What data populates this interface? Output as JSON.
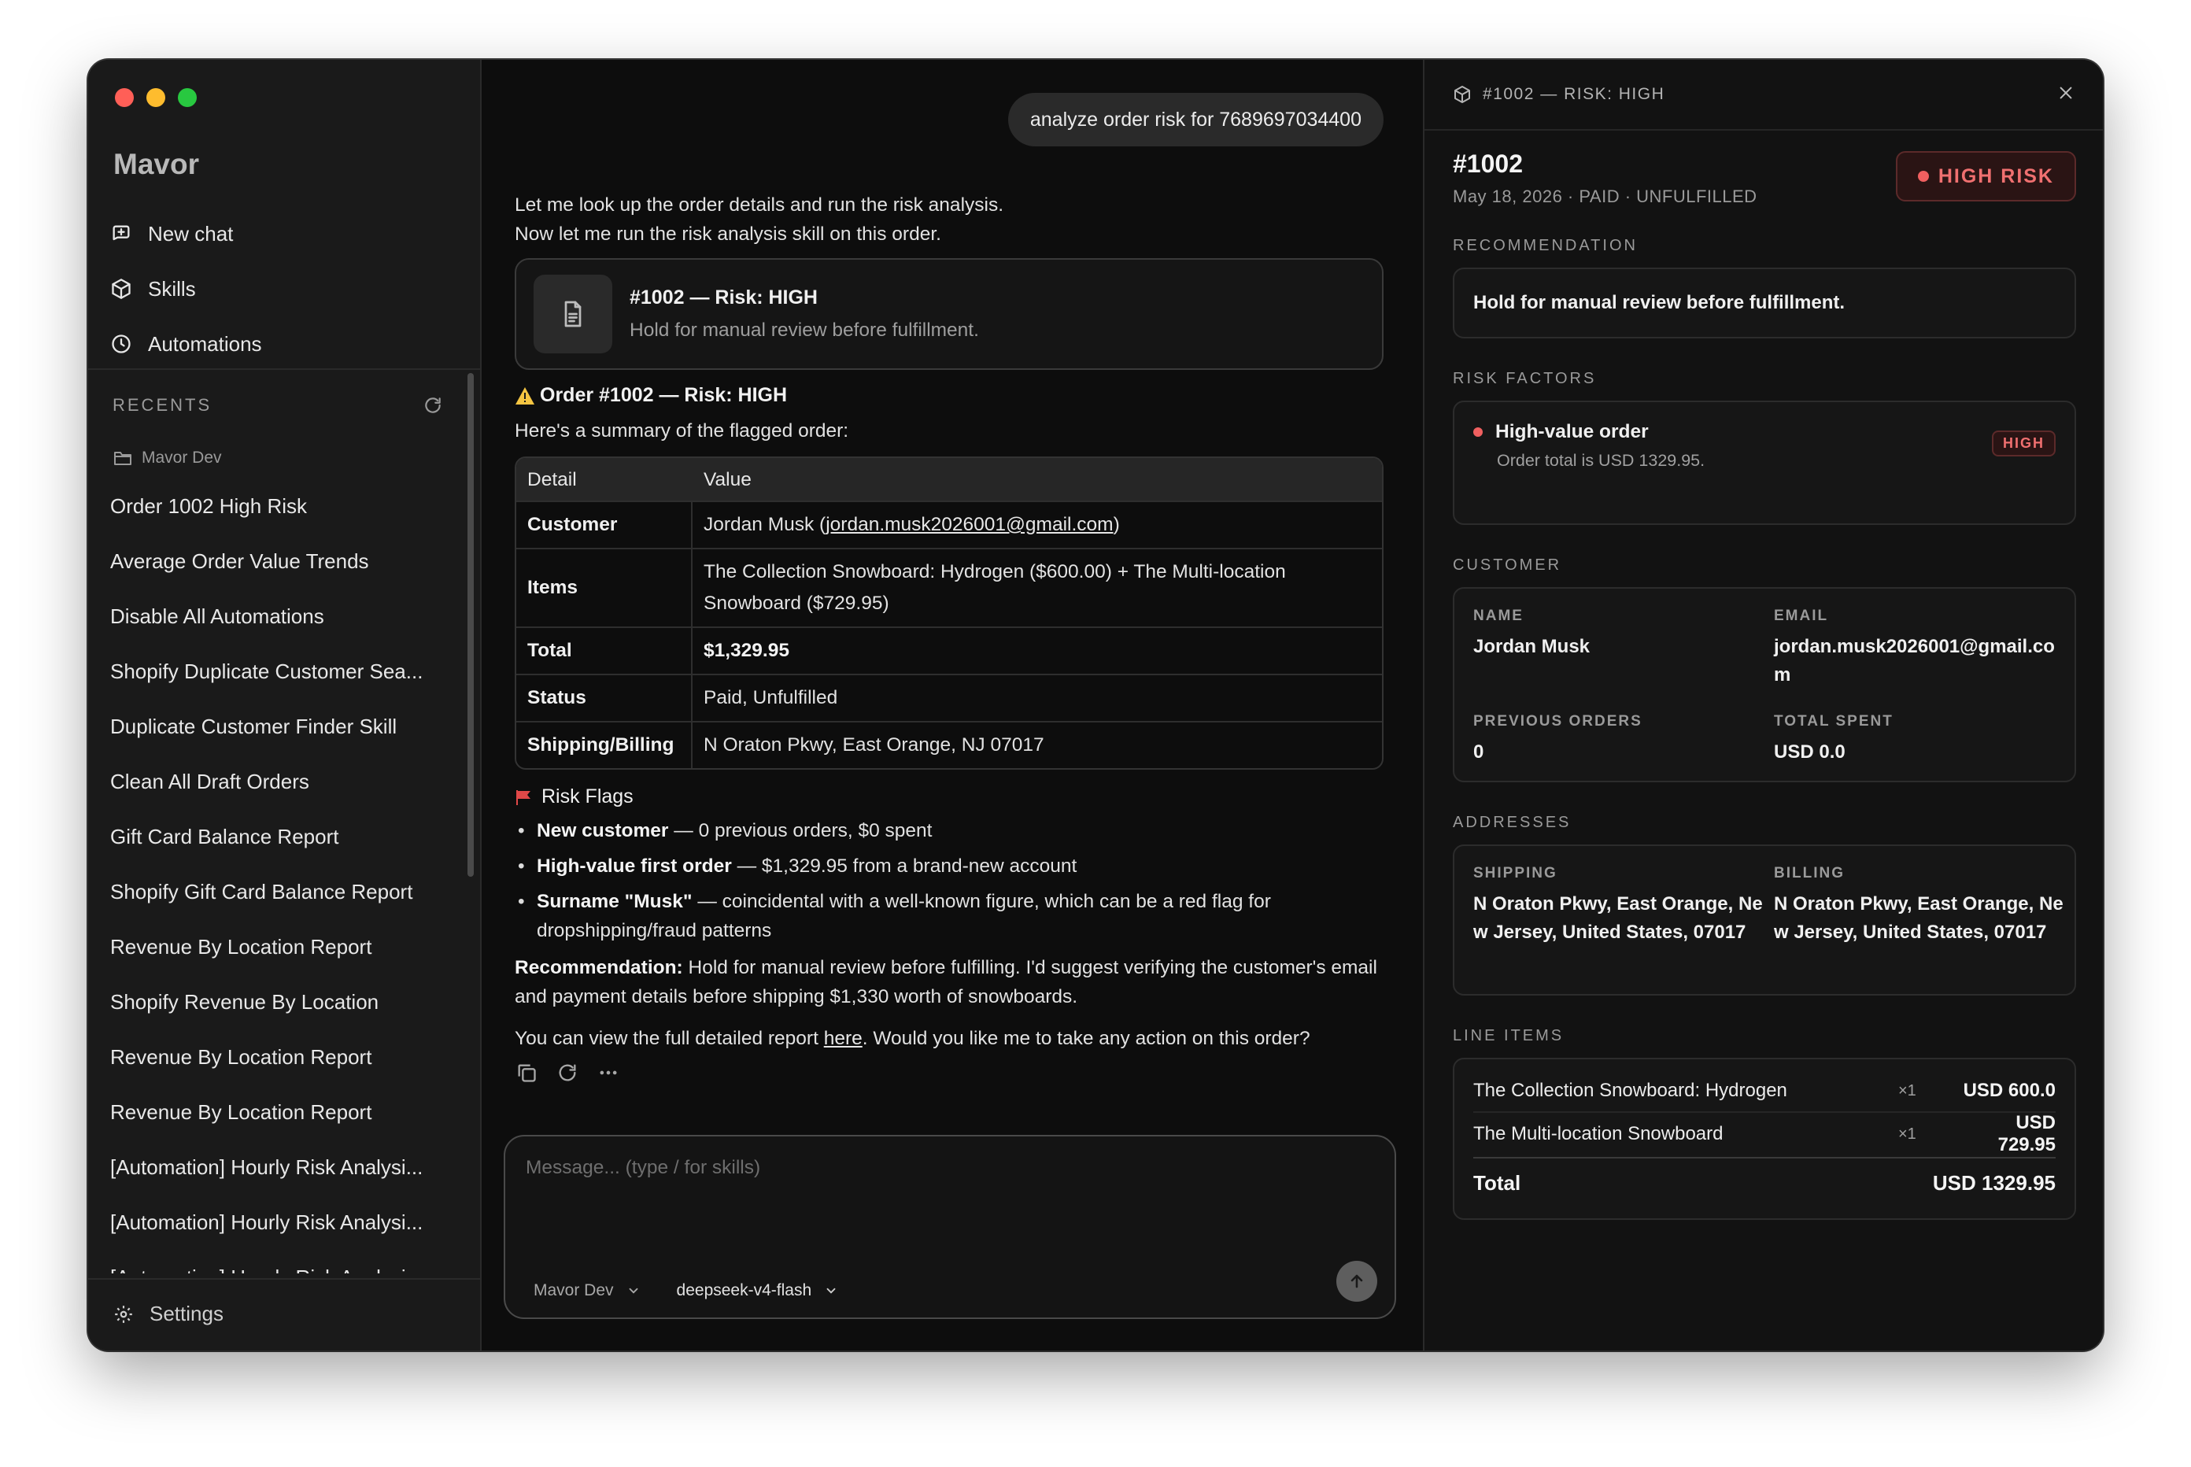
{
  "app": {
    "name": "Mavor"
  },
  "sidebar": {
    "nav": [
      {
        "label": "New chat",
        "icon": "new-chat-icon"
      },
      {
        "label": "Skills",
        "icon": "skills-icon"
      },
      {
        "label": "Automations",
        "icon": "clock-icon"
      }
    ],
    "recents_label": "RECENTS",
    "folder": "Mavor Dev",
    "recents": [
      "Order 1002 High Risk",
      "Average Order Value Trends",
      "Disable All Automations",
      "Shopify Duplicate Customer Sea...",
      "Duplicate Customer Finder Skill",
      "Clean All Draft Orders",
      "Gift Card Balance Report",
      "Shopify Gift Card Balance Report",
      "Revenue By Location Report",
      "Shopify Revenue By Location",
      "Revenue By Location Report",
      "Revenue By Location Report",
      "[Automation] Hourly Risk Analysi...",
      "[Automation] Hourly Risk Analysi...",
      "[Automation] Hourly Risk Analysi..."
    ],
    "settings_label": "Settings"
  },
  "chat": {
    "user_message": "analyze order risk for 7689697034400",
    "intro_line1": "Let me look up the order details and run the risk analysis.",
    "intro_line2": "Now let me run the risk analysis skill on this order.",
    "card_title": "#1002 — Risk: HIGH",
    "card_subtitle": "Hold for manual review before fulfillment.",
    "heading_prefix": "Order #1002 — Risk: ",
    "heading_level": "HIGH",
    "summary_intro": "Here's a summary of the flagged order:",
    "table": {
      "headers": [
        "Detail",
        "Value"
      ],
      "customer_label": "Customer",
      "customer_name": "Jordan Musk (",
      "customer_email": "jordan.musk2026001@gmail.com",
      "customer_close": ")",
      "items_label": "Items",
      "items_value": "The Collection Snowboard: Hydrogen ($600.00) + The Multi-location Snowboard ($729.95)",
      "total_label": "Total",
      "total_value": "$1,329.95",
      "status_label": "Status",
      "status_value": "Paid, Unfulfilled",
      "shipping_label": "Shipping/Billing",
      "shipping_value": "N Oraton Pkwy, East Orange, NJ 07017"
    },
    "flags_heading": "Risk Flags",
    "flags": [
      {
        "bold": "New customer",
        "text": " — 0 previous orders, $0 spent"
      },
      {
        "bold": "High-value first order",
        "text": " — $1,329.95 from a brand-new account"
      },
      {
        "bold": "Surname \"Musk\"",
        "text": " — coincidental with a well-known figure, which can be a red flag for dropshipping/fraud patterns"
      }
    ],
    "rec_label": "Recommendation:",
    "rec_text": " Hold for manual review before fulfilling. I'd suggest verifying the customer's email and payment details before shipping $1,330 worth of snowboards.",
    "view_prefix": "You can view the full detailed report ",
    "view_link": "here",
    "view_suffix": ". Would you like me to take any action on this order?",
    "composer_placeholder": "Message... (type / for skills)",
    "workspace": "Mavor Dev",
    "model": "deepseek-v4-flash"
  },
  "panel": {
    "header": "#1002 — RISK: HIGH",
    "order_id": "#1002",
    "meta": "May 18, 2026 · PAID · UNFULFILLED",
    "risk_badge": "HIGH RISK",
    "recommendation_label": "RECOMMENDATION",
    "recommendation": "Hold for manual review before fulfillment.",
    "risk_factors_label": "RISK FACTORS",
    "risk_factor_title": "High-value order",
    "risk_factor_sub": "Order total is USD 1329.95.",
    "risk_factor_badge": "HIGH",
    "customer_label": "CUSTOMER",
    "customer": {
      "name_label": "NAME",
      "name": "Jordan Musk",
      "email_label": "EMAIL",
      "email": "jordan.musk2026001@gmail.com",
      "prev_label": "PREVIOUS ORDERS",
      "prev": "0",
      "spent_label": "TOTAL SPENT",
      "spent": "USD 0.0"
    },
    "addresses_label": "ADDRESSES",
    "addresses": {
      "shipping_label": "SHIPPING",
      "shipping": "N Oraton Pkwy, East Orange, New Jersey, United States, 07017",
      "billing_label": "BILLING",
      "billing": "N Oraton Pkwy, East Orange, New Jersey, United States, 07017"
    },
    "line_items_label": "LINE ITEMS",
    "line_items": [
      {
        "name": "The Collection Snowboard: Hydrogen",
        "qty": "×1",
        "price": "USD 600.0"
      },
      {
        "name": "The Multi-location Snowboard",
        "qty": "×1",
        "price": "USD 729.95"
      }
    ],
    "total_label": "Total",
    "total": "USD 1329.95"
  },
  "colors": {
    "accent_red": "#f06060",
    "bg": "#0d0d0d",
    "sidebar": "#1a1a1a"
  }
}
